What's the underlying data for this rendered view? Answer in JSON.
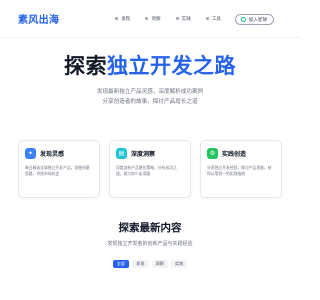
{
  "header": {
    "logo": "素风出海",
    "nav": [
      "发现",
      "洞察",
      "实践",
      "工具"
    ],
    "join_label": "加入星球"
  },
  "hero": {
    "title_part1": "探索",
    "title_part2": "独立开发之路",
    "subtitle_line1": "发现最新独立产品灵感，深度解析成功案例",
    "subtitle_line2": "分享创造者的故事，探讨产品增长之道"
  },
  "cards": [
    {
      "title": "发现灵感",
      "icon": "lightbulb-icon",
      "desc": "每日精选全球独立开发产品，发掘创意思路，寻找市场机会"
    },
    {
      "title": "深度洞察",
      "icon": "chart-icon",
      "desc": "深度剖析产品增长策略，分析成功之道，助力你少走弯路"
    },
    {
      "title": "实践创造",
      "icon": "tools-icon",
      "desc": "分享独立开发经验，探讨产品思维，给你从零到一的实践指南"
    }
  ],
  "latest": {
    "title": "探索最新内容",
    "subtitle": "发现独立开发者的创新产品与实践经验",
    "tabs": [
      "全部",
      "发现",
      "洞察",
      "实践"
    ],
    "active_tab": "全部"
  },
  "colors": {
    "accent": "#2563eb",
    "card_blue": "#3b82f6",
    "card_cyan": "#22c4d8",
    "card_green": "#22c55e"
  }
}
